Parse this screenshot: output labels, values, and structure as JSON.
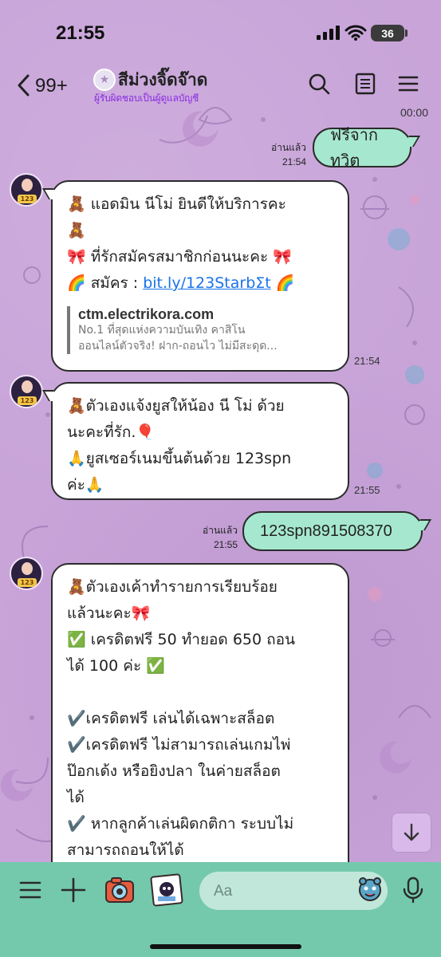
{
  "status": {
    "time": "21:55",
    "battery": "36"
  },
  "header": {
    "back_count": "99+",
    "title": "สีม่วงจิ๊ดจ๊าด",
    "subtitle": "ผู้รับผิดชอบเป็นผู้ดูแลบัญชี",
    "top_time": "00:00"
  },
  "messages": [
    {
      "type": "out",
      "read": "อ่านแล้ว",
      "time": "21:54",
      "text": "ฟรีจากทวิต"
    },
    {
      "type": "in",
      "time": "21:54",
      "lines": [
        "🧸 แอดมิน นีโม่ ยินดีให้บริการคะ",
        "🧸",
        "🎀 ที่รักสมัครสมาชิกก่อนนะคะ 🎀"
      ],
      "link_prefix": "🌈 สมัคร : ",
      "link_text": "bit.ly/123StarbΣt",
      "link_suffix": " 🌈",
      "preview": {
        "domain": "ctm.electrikora.com",
        "desc1": "No.1 ที่สุดแห่งความบันเทิง คาสิโน",
        "desc2": "ออนไลน์ตัวจริง! ฝาก-ถอนไว ไม่มีสะดุด..."
      }
    },
    {
      "type": "in",
      "time": "21:55",
      "lines": [
        "🧸ตัวเองแจ้งยูสให้น้อง นี โม่ ด้วย",
        "นะคะที่รัก.🎈",
        "  🙏ยูสเซอร์เนมขึ้นต้นด้วย 123spn",
        "ค่ะ🙏"
      ]
    },
    {
      "type": "out",
      "read": "อ่านแล้ว",
      "time": "21:55",
      "text": "123spn891508370"
    },
    {
      "type": "in",
      "lines": [
        "🧸ตัวเองเค้าทำรายการเรียบร้อย",
        "แล้วนะคะ🎀",
        "✅ เครดิตฟรี 50 ทำยอด 650 ถอน",
        "ได้ 100 ค่ะ ✅",
        "",
        "✔️เครดิตฟรี เล่นได้เฉพาะสล็อต",
        "✔️เครดิตฟรี ไม่สามารถเล่นเกมไพ่",
        "ป๊อกเด้ง หรือยิงปลา ในค่ายสล็อต",
        "ได้",
        "✔️ หากลูกค้าเล่นผิดกติกา ระบบไม่",
        "สามารถถอนให้ได้"
      ]
    }
  ],
  "input": {
    "placeholder": "Aa"
  },
  "colors": {
    "wallpaper": "#c8a4d9",
    "bottom_bar": "#74c9ac",
    "outgoing_bubble": "#a6e8cf",
    "link": "#1a73e8"
  },
  "icons": [
    "back-icon",
    "search-icon",
    "notes-icon",
    "menu-icon",
    "hamburger-icon",
    "plus-icon",
    "camera-icon",
    "photo-icon",
    "emoji-icon",
    "mic-icon",
    "arrow-down-icon"
  ]
}
